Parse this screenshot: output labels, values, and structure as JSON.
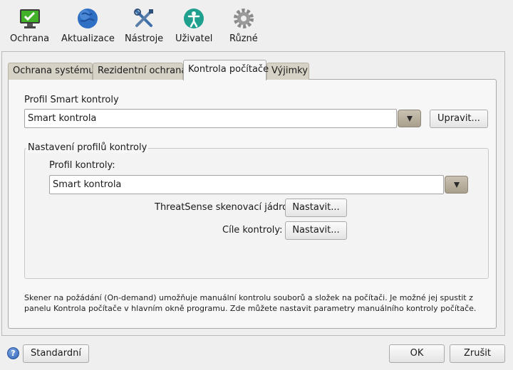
{
  "toolbar": {
    "items": [
      {
        "label": "Ochrana",
        "icon": "shield-check-icon"
      },
      {
        "label": "Aktualizace",
        "icon": "globe-icon"
      },
      {
        "label": "Nástroje",
        "icon": "tools-icon"
      },
      {
        "label": "Uživatel",
        "icon": "user-icon"
      },
      {
        "label": "Různé",
        "icon": "gear-icon"
      }
    ]
  },
  "tabs": [
    {
      "label": "Ochrana systému",
      "active": false
    },
    {
      "label": "Rezidentní ochrana",
      "active": false
    },
    {
      "label": "Kontrola počítače",
      "active": true
    },
    {
      "label": "Výjimky",
      "active": false
    }
  ],
  "smart": {
    "label": "Profil Smart kontroly",
    "value": "Smart kontrola",
    "edit_button": "Upravit..."
  },
  "profiles_group": {
    "title": "Nastavení profilů kontroly",
    "profile_label": "Profil kontroly:",
    "profile_value": "Smart kontrola",
    "engine_label": "ThreatSense skenovací jádro",
    "engine_button": "Nastavit...",
    "targets_label": "Cíle kontroly:",
    "targets_button": "Nastavit..."
  },
  "description": "Skener na požádání (On-demand) umožňuje manuální kontrolu souborů a složek na počítači. Je možné jej spustit z panelu Kontrola počítače v hlavním okně programu. Zde můžete nastavit parametry manuálního kontroly počítače.",
  "footer": {
    "help_glyph": "?",
    "default_button": "Standardní",
    "ok_button": "OK",
    "cancel_button": "Zrušit"
  },
  "colors": {
    "tab_inactive": "#d7d2c6",
    "panel_bg": "#f7f7f7",
    "dropdown_btn": "#b3aa98"
  }
}
